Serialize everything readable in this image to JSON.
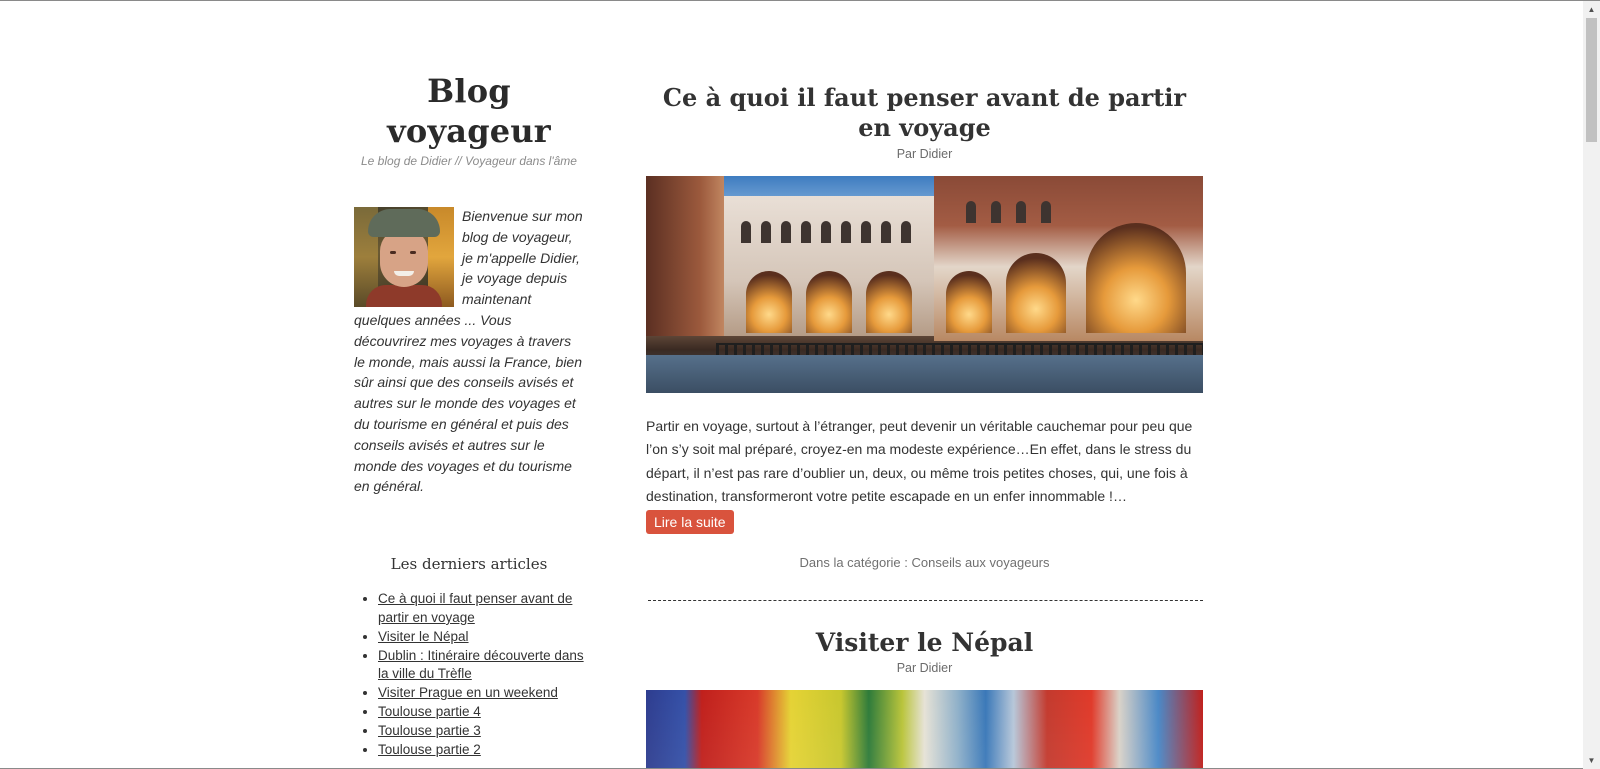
{
  "site": {
    "title": "Blog voyageur",
    "tagline": "Le blog de Didier // Voyageur dans l'âme"
  },
  "sidebar": {
    "avatar_alt": "Photo de Didier",
    "intro": "Bienvenue sur mon blog de voyageur, je m'appelle Didier, je voyage depuis maintenant quelques années ... Vous découvrirez mes voyages à travers le monde, mais aussi la France, bien sûr ainsi que des conseils avisés et autres sur le monde des voyages et du tourisme en général et puis des conseils avisés et autres sur le monde des voyages et du tourisme en général.",
    "recent_title": "Les derniers articles",
    "recent_items": [
      "Ce à quoi il faut penser avant de partir en voyage",
      "Visiter le Népal",
      "Dublin : Itinéraire découverte dans la ville du Trèfle",
      "Visiter Prague en un weekend",
      "Toulouse partie 4",
      "Toulouse partie 3",
      "Toulouse partie 2"
    ]
  },
  "posts": [
    {
      "title": "Ce à quoi il faut penser avant de partir en voyage",
      "author": "Par Didier",
      "excerpt": "Partir en voyage, surtout à l’étranger, peut devenir un véritable cauchemar pour peu que l’on s’y soit mal préparé, croyez-en ma modeste expérience…En effet, dans le stress du départ, il n’est pas rare d’oublier un, deux, ou même trois petites choses, qui, une fois à destination, transformeront votre petite escapade en un enfer innommable !…",
      "read_more": "Lire la suite",
      "category": "Dans la catégorie : Conseils aux voyageurs"
    },
    {
      "title": "Visiter le Népal",
      "author": "Par Didier"
    }
  ],
  "icons": {
    "scroll_up": "scroll-up-icon",
    "scroll_down": "scroll-down-icon"
  },
  "colors": {
    "accent": "#d9533d",
    "text": "#333333",
    "meta": "#707070"
  }
}
